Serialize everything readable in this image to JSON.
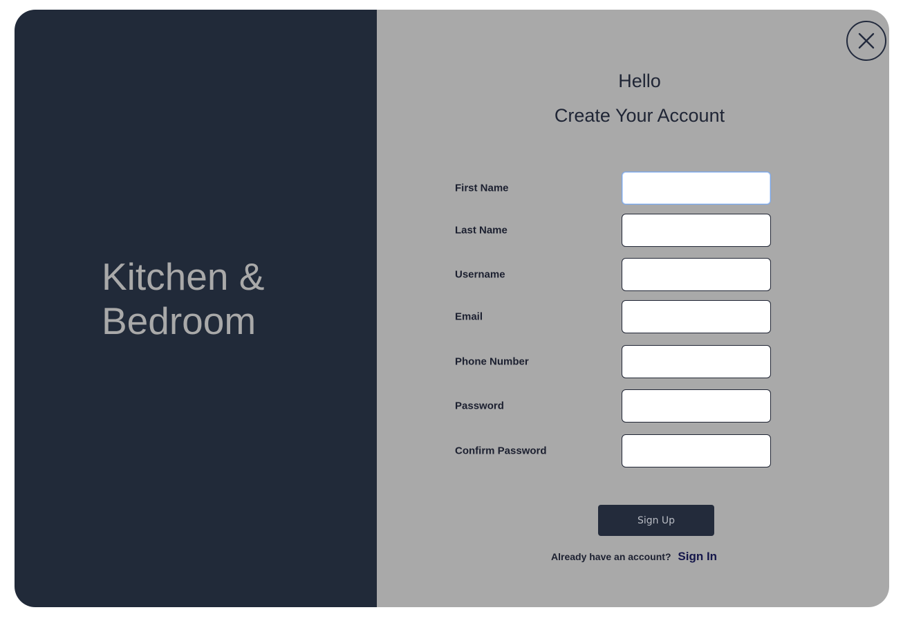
{
  "brand": {
    "line1": "Kitchen &",
    "line2": "Bedroom"
  },
  "header": {
    "hello": "Hello",
    "subtitle": "Create Your Account"
  },
  "form": {
    "fields": [
      {
        "label": "First Name",
        "value": ""
      },
      {
        "label": "Last Name",
        "value": ""
      },
      {
        "label": "Username",
        "value": ""
      },
      {
        "label": "Email",
        "value": ""
      },
      {
        "label": "Phone Number",
        "value": ""
      },
      {
        "label": "Password",
        "value": ""
      },
      {
        "label": "Confirm Password",
        "value": ""
      }
    ],
    "submit_label": "Sign Up"
  },
  "footer": {
    "prompt": "Already have an account?",
    "link_label": "Sign In"
  },
  "icons": {
    "close": "close-icon"
  },
  "colors": {
    "left_panel": "#212a39",
    "right_panel": "#a9a9a9",
    "button": "#232b3b",
    "link": "#14164a",
    "brand_text": "#a9a9a9"
  }
}
